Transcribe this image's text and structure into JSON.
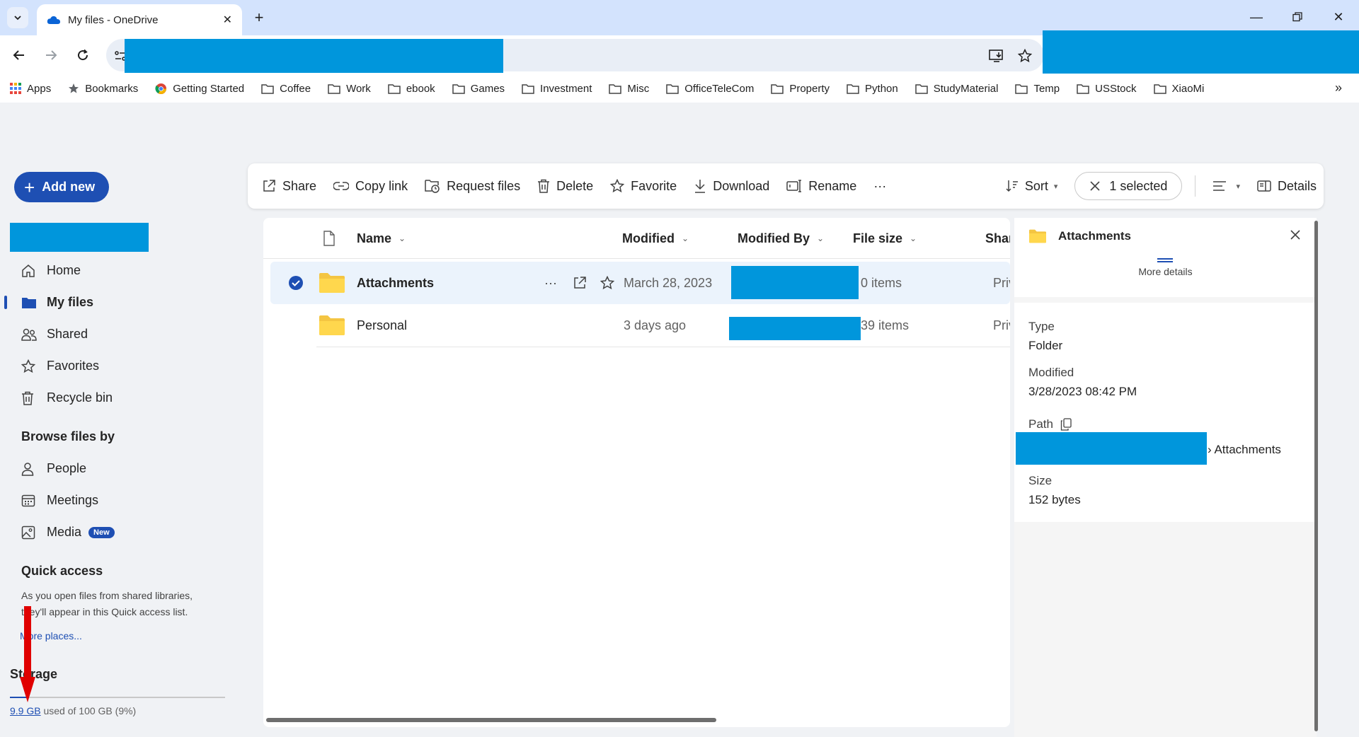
{
  "browser": {
    "tab_title": "My files - OneDrive",
    "bookmarks": [
      {
        "label": "Apps",
        "icon": "apps-grid-icon"
      },
      {
        "label": "Bookmarks",
        "icon": "star-icon"
      },
      {
        "label": "Getting Started",
        "icon": "chrome-icon"
      },
      {
        "label": "Coffee",
        "icon": "folder-icon"
      },
      {
        "label": "Work",
        "icon": "folder-icon"
      },
      {
        "label": "ebook",
        "icon": "folder-icon"
      },
      {
        "label": "Games",
        "icon": "folder-icon"
      },
      {
        "label": "Investment",
        "icon": "folder-icon"
      },
      {
        "label": "Misc",
        "icon": "folder-icon"
      },
      {
        "label": "OfficeTeleCom",
        "icon": "folder-icon"
      },
      {
        "label": "Property",
        "icon": "folder-icon"
      },
      {
        "label": "Python",
        "icon": "folder-icon"
      },
      {
        "label": "StudyMaterial",
        "icon": "folder-icon"
      },
      {
        "label": "Temp",
        "icon": "folder-icon"
      },
      {
        "label": "USStock",
        "icon": "folder-icon"
      },
      {
        "label": "XiaoMi",
        "icon": "folder-icon"
      }
    ],
    "bookmarks_overflow": "»"
  },
  "app": {
    "add_new_label": "Add new",
    "nav": {
      "home": "Home",
      "my_files": "My files",
      "shared": "Shared",
      "favorites": "Favorites",
      "recycle_bin": "Recycle bin"
    },
    "browse_by": {
      "title": "Browse files by",
      "people": "People",
      "meetings": "Meetings",
      "media": "Media",
      "media_badge": "New"
    },
    "quick_access": {
      "title": "Quick access",
      "description": "As you open files from shared libraries, they'll appear in this Quick access list.",
      "more": "More places..."
    },
    "storage": {
      "title": "Storage",
      "used": "9.9 GB",
      "rest": " used of 100 GB (9%)",
      "used_fraction": 0.09
    },
    "commands": {
      "share": "Share",
      "copy_link": "Copy link",
      "request_files": "Request files",
      "delete": "Delete",
      "favorite": "Favorite",
      "download": "Download",
      "rename": "Rename",
      "more": "···",
      "sort": "Sort",
      "selected": "1 selected",
      "details": "Details"
    },
    "columns": {
      "name": "Name",
      "modified": "Modified",
      "modified_by": "Modified By",
      "file_size": "File size",
      "sharing": "Shar"
    },
    "rows": [
      {
        "name": "Attachments",
        "modified": "March 28, 2023",
        "size": "0 items",
        "sharing": "Priva",
        "selected": true
      },
      {
        "name": "Personal",
        "modified": "3 days ago",
        "size": "39 items",
        "sharing": "Priva",
        "selected": false
      }
    ],
    "details": {
      "title": "Attachments",
      "more_details": "More details",
      "type_label": "Type",
      "type_value": "Folder",
      "modified_label": "Modified",
      "modified_value": "3/28/2023 08:42 PM",
      "path_label": "Path",
      "path_tail": "› Attachments",
      "size_label": "Size",
      "size_value": "152 bytes"
    }
  },
  "colors": {
    "accent": "#1e4fb3",
    "redaction": "#0096dc",
    "folder": "#f4c542",
    "annotation_arrow": "#e00000"
  }
}
